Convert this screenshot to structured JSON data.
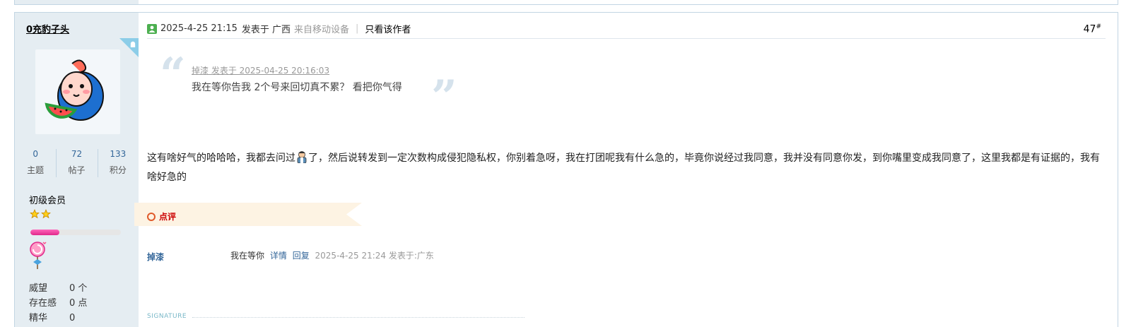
{
  "user": {
    "name": "0充豹子头",
    "stats": [
      {
        "value": "0",
        "label": "主题"
      },
      {
        "value": "72",
        "label": "帖子"
      },
      {
        "value": "133",
        "label": "积分"
      }
    ],
    "rank": "初级会员",
    "star_count": 2,
    "progress_fraction": 0.32,
    "attributes": [
      {
        "key": "威望",
        "value": "0 个"
      },
      {
        "key": "存在感",
        "value": "0 点"
      },
      {
        "key": "精华",
        "value": "0"
      }
    ]
  },
  "post": {
    "datetime": "2025-4-25 21:15",
    "posted_from": "发表于 广西",
    "device": "来自移动设备",
    "separator": "|",
    "only_author": "只看该作者",
    "floor": "47",
    "floor_sup": "#",
    "quote": {
      "meta": "掉漆 发表于 2025-04-25 20:16:03",
      "text": "我在等你告我 2个号来回切真不累？ 看把你气得"
    },
    "body_part1": "这有啥好气的哈哈哈，我都去问过",
    "body_part2": "了，然后说转发到一定次数构成侵犯隐私权，你别着急呀，我在打团呢我有什么急的，毕竟你说经过我同意，我并没有同意你发，到你嘴里变成我同意了，这里我都是有证据的，我有啥好急的"
  },
  "comment": {
    "section_label": "点评",
    "author": "掉漆",
    "text": "我在等你",
    "detail_link": "详情",
    "reply_link": "回复",
    "meta": "2025-4-25 21:24 发表于:广东"
  },
  "signature_label": "SIGNATURE",
  "colors": {
    "sidebar_bg": "#e5edf2",
    "border": "#c2d5e3",
    "link": "#336699",
    "comment_red": "#cc0000",
    "progress_pink": "#e0288a"
  },
  "icons": [
    "online-icon",
    "android-corner-icon",
    "star-icon",
    "lollipop-medal-icon",
    "doctor-emoji-icon"
  ]
}
